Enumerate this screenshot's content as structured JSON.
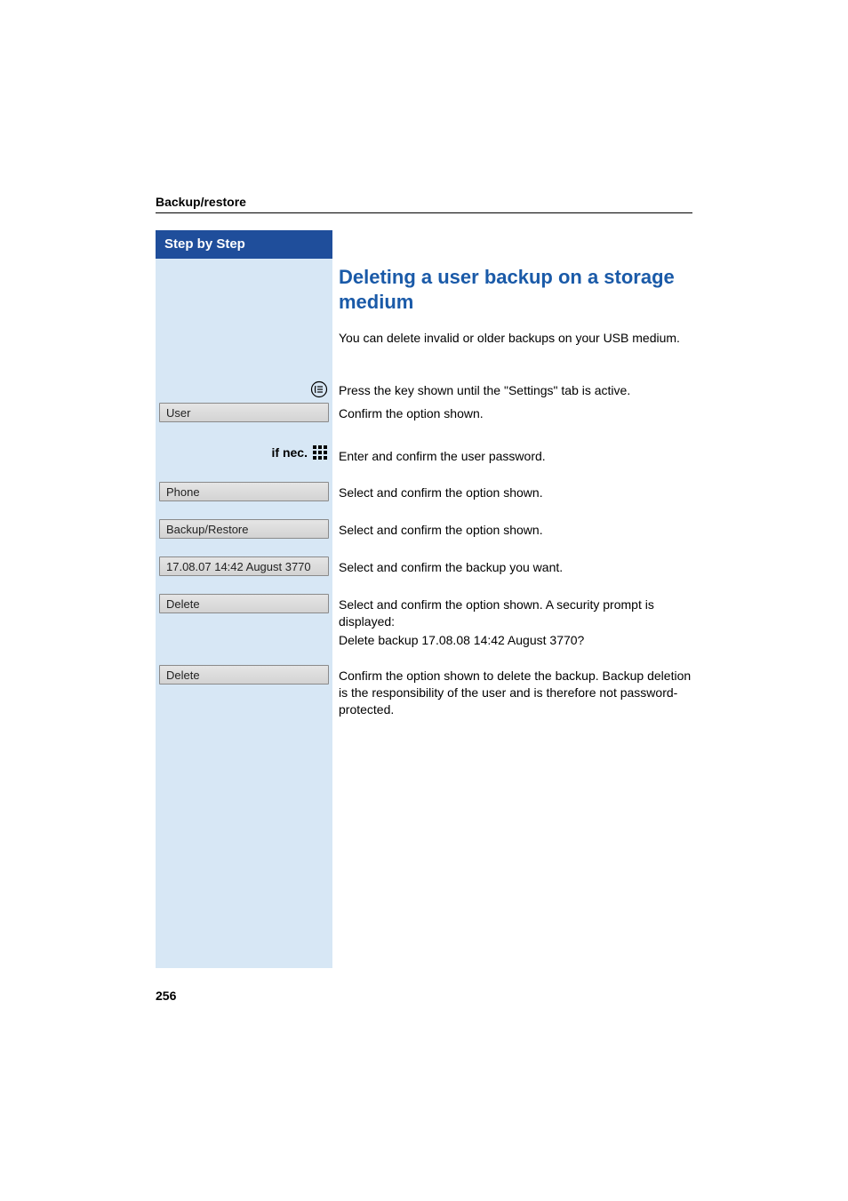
{
  "header": {
    "section_title": "Backup/restore"
  },
  "sidebar": {
    "header": "Step by Step",
    "if_nec_label": "if nec.",
    "items": [
      {
        "label": "User"
      },
      {
        "label": "Phone"
      },
      {
        "label": "Backup/Restore"
      },
      {
        "label": "17.08.07 14:42 August 3770"
      },
      {
        "label": "Delete"
      },
      {
        "label": "Delete"
      }
    ]
  },
  "content": {
    "title": "Deleting a user backup on a storage medium",
    "intro": "You can delete invalid or older backups on your USB medium.",
    "instructions": {
      "settings_key": "Press the key shown until the \"Settings\" tab is active.",
      "user": "Confirm the option shown.",
      "password": "Enter and confirm the user password.",
      "phone": "Select and confirm the option shown.",
      "backup_restore": "Select and confirm the option shown.",
      "select_backup": "Select and confirm the backup you want.",
      "delete_prompt_1": "Select and confirm the option shown. A security prompt is displayed:",
      "delete_prompt_2": "Delete backup 17.08.08 14:42 August 3770?",
      "confirm_delete": "Confirm the option shown to delete the backup. Backup deletion is the responsibility of the user and is therefore not password-protected."
    }
  },
  "page_number": "256"
}
